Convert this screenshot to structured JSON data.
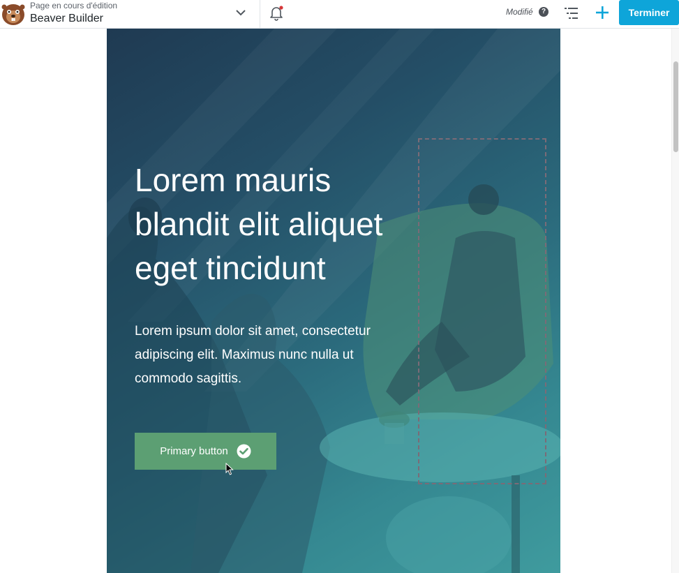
{
  "topbar": {
    "subtitle": "Page en cours d'édition",
    "title": "Beaver Builder",
    "status": "Modifié",
    "help_glyph": "?",
    "done_label": "Terminer",
    "logo_icon": "beaver-logo-icon",
    "icons": [
      "chevron-down-icon",
      "bell-icon",
      "help-icon",
      "outline-icon",
      "plus-icon"
    ],
    "accent_color": "#0ea5d9",
    "notification_dot_color": "#d63638"
  },
  "hero": {
    "title": "Lorem mauris blandit elit aliquet eget tincidunt",
    "text": "Lorem ipsum dolor sit amet, consectetur adipiscing elit. Maximus nunc nulla ut commodo sagittis.",
    "button_label": "Primary button",
    "button_icon": "check-circle-icon",
    "button_color": "#5c9f73"
  }
}
